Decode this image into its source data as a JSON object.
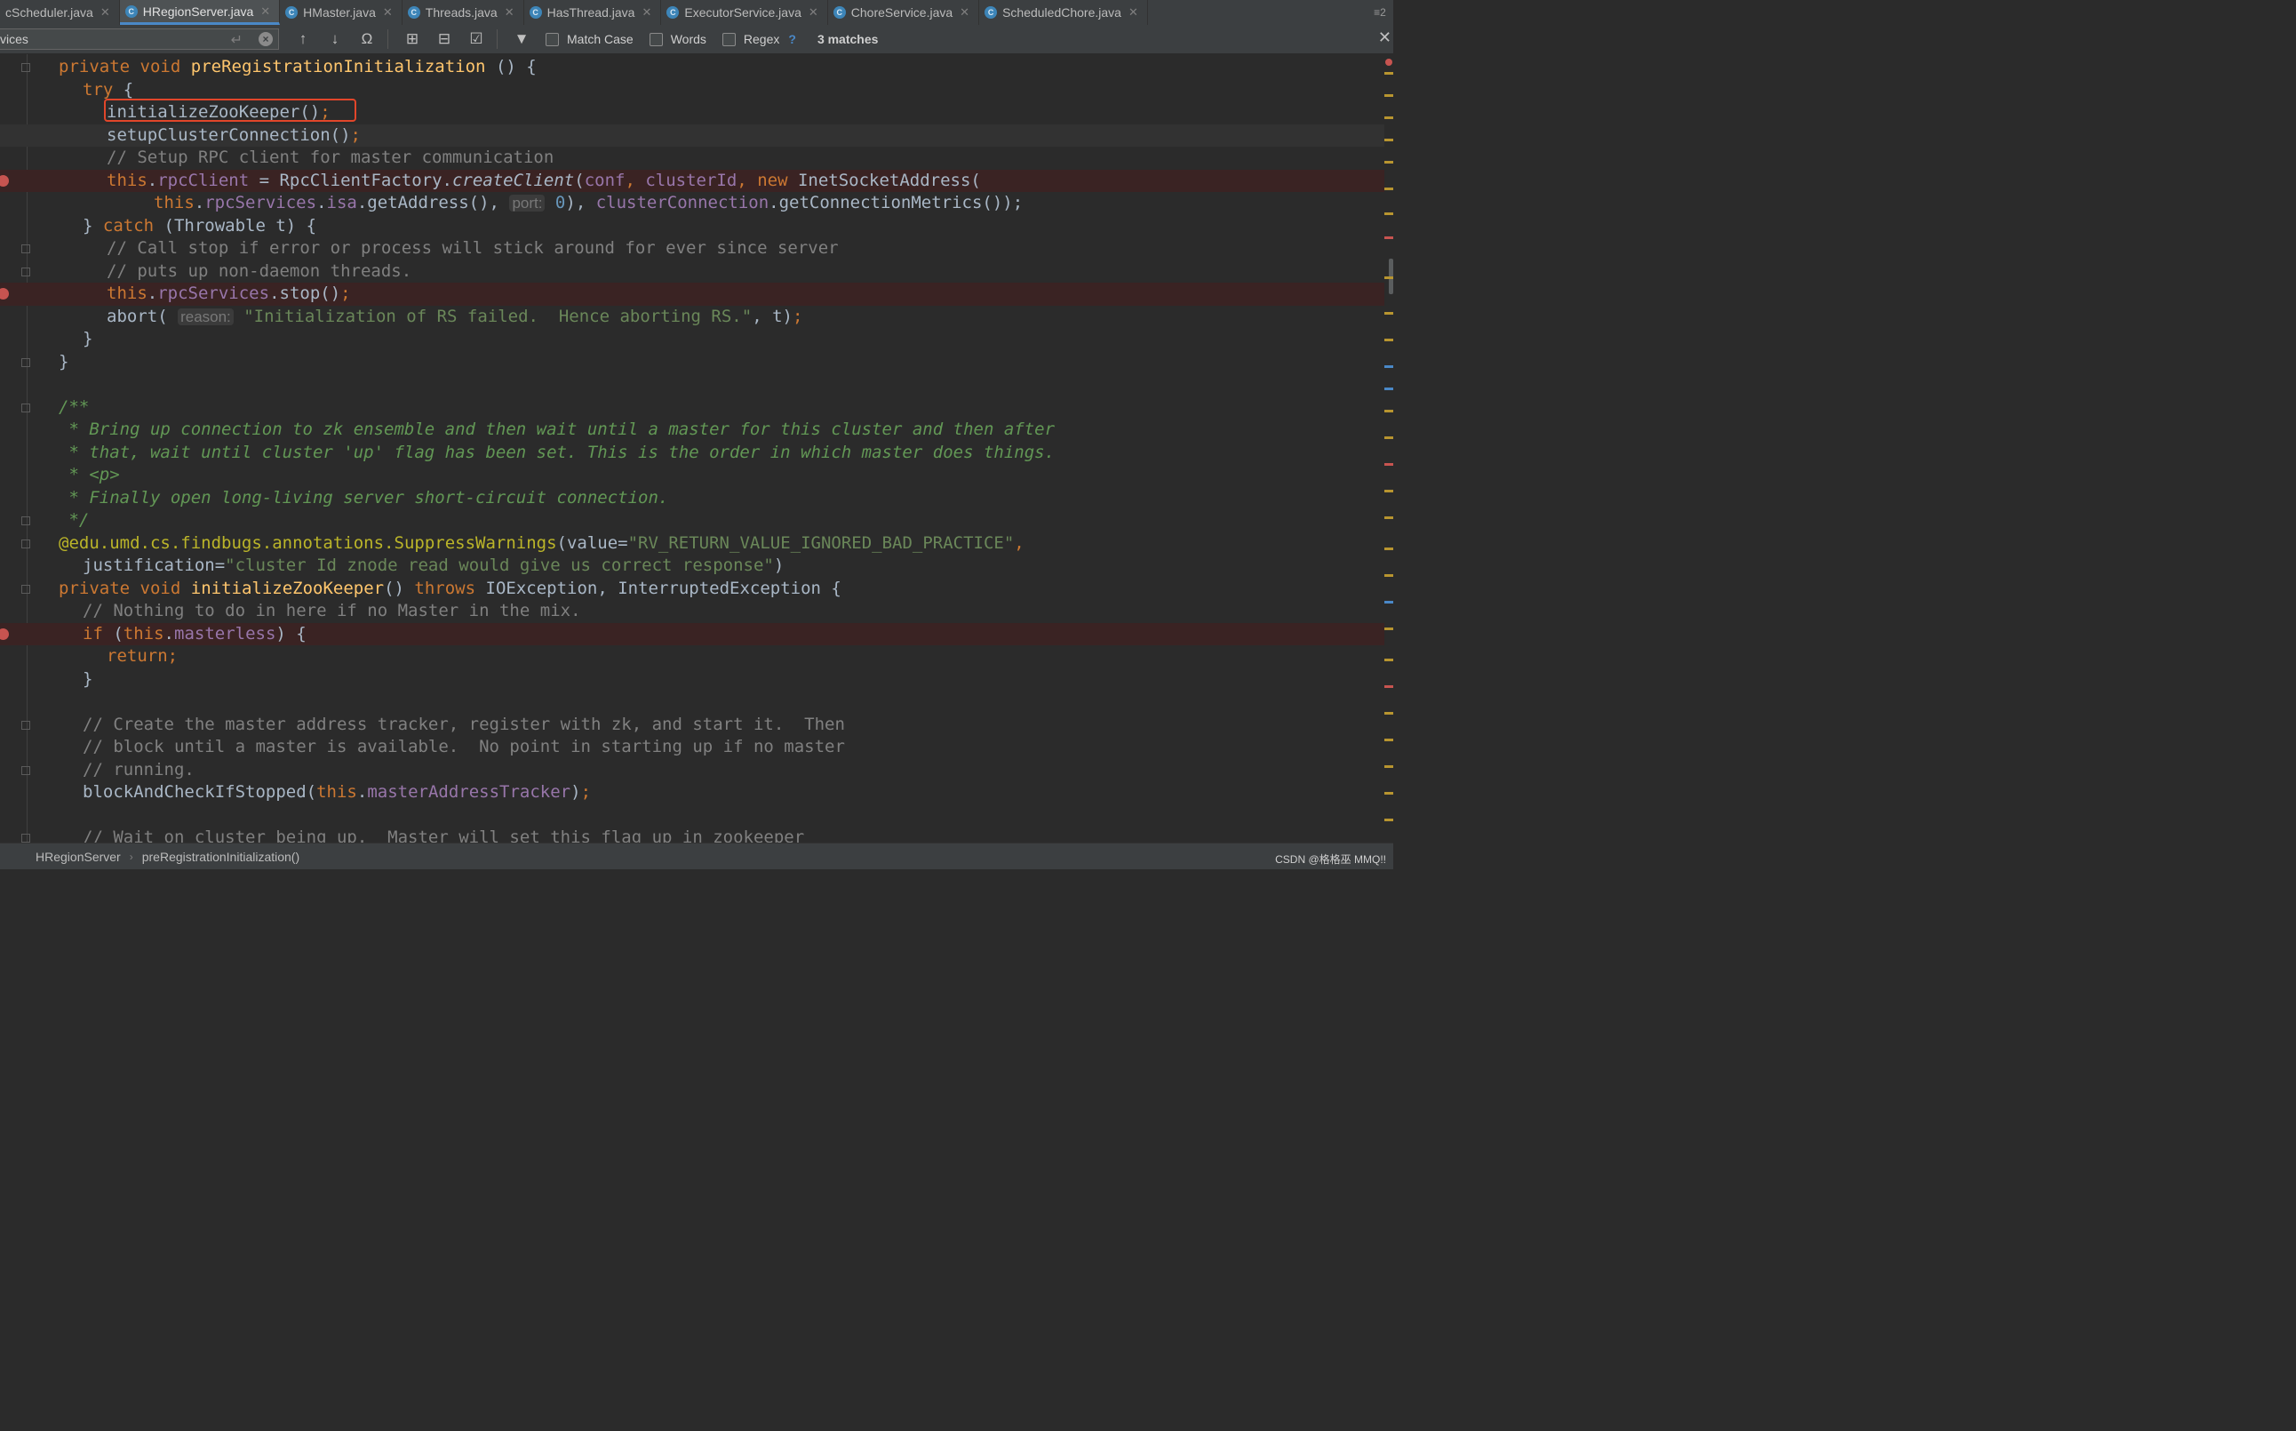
{
  "tabs": [
    {
      "label": "cScheduler.java",
      "icon": "",
      "active": false
    },
    {
      "label": "HRegionServer.java",
      "icon": "C",
      "active": true
    },
    {
      "label": "HMaster.java",
      "icon": "C",
      "active": false
    },
    {
      "label": "Threads.java",
      "icon": "C",
      "active": false
    },
    {
      "label": "HasThread.java",
      "icon": "C",
      "active": false
    },
    {
      "label": "ExecutorService.java",
      "icon": "C",
      "active": false
    },
    {
      "label": "ChoreService.java",
      "icon": "C",
      "active": false
    },
    {
      "label": "ScheduledChore.java",
      "icon": "C",
      "active": false
    }
  ],
  "tab_menu_label": "≡2",
  "search": {
    "value": "vices",
    "match_case_label": "Match Case",
    "words_label": "Words",
    "regex_label": "Regex",
    "regex_help": "?",
    "match_count": "3 matches"
  },
  "code": {
    "l1": [
      "private",
      "void",
      "preRegistrationInitialization",
      "() {"
    ],
    "l2": [
      "try",
      " {"
    ],
    "l3": [
      "initializeZooKeeper()",
      ";"
    ],
    "l4": [
      "setupClusterConnection()",
      ";"
    ],
    "l5": "// Setup RPC client for master communication",
    "l6": [
      "this",
      ".",
      "rpcClient",
      " = RpcClientFactory.",
      "createClient",
      "(",
      "conf",
      ", ",
      "clusterId",
      ", ",
      "new",
      " InetSocketAddress("
    ],
    "l7": [
      "this",
      ".",
      "rpcServices",
      ".",
      "isa",
      ".getAddress(), ",
      "port:",
      " ",
      "0",
      "), ",
      "clusterConnection",
      ".getConnectionMetrics());"
    ],
    "l8": [
      "} ",
      "catch",
      " (Throwable t) {"
    ],
    "l9": "// Call stop if error or process will stick around for ever since server",
    "l10": "// puts up non-daemon threads.",
    "l11": [
      "this",
      ".",
      "rpcServices",
      ".stop()",
      ";"
    ],
    "l12": [
      "abort( ",
      "reason:",
      " ",
      "\"Initialization of RS failed.  Hence aborting RS.\"",
      ", t)",
      ";"
    ],
    "l13": "}",
    "l14": "}",
    "l16": "/**",
    "l17": " * Bring up connection to zk ensemble and then wait until a master for this cluster and then after",
    "l18": " * that, wait until cluster 'up' flag has been set. This is the order in which master does things.",
    "l19": " * <p>",
    "l20": " * Finally open long-living server short-circuit connection.",
    "l21": " */",
    "l22": [
      "@edu.umd.cs.findbugs.annotations.",
      "SuppressWarnings",
      "(value=",
      "\"RV_RETURN_VALUE_IGNORED_BAD_PRACTICE\"",
      ","
    ],
    "l23": [
      "justification=",
      "\"cluster Id znode read would give us correct response\"",
      ")"
    ],
    "l24": [
      "private",
      "void",
      "initializeZooKeeper",
      "() ",
      "throws",
      " IOException, InterruptedException {"
    ],
    "l25": "// Nothing to do in here if no Master in the mix.",
    "l26": [
      "if",
      " (",
      "this",
      ".",
      "masterless",
      ") {"
    ],
    "l27": [
      "return",
      ";"
    ],
    "l28": "}",
    "l30": "// Create the master address tracker, register with zk, and start it.  Then",
    "l31": "// block until a master is available.  No point in starting up if no master",
    "l32": "// running.",
    "l33": [
      "blockAndCheckIfStopped(",
      "this",
      ".",
      "masterAddressTracker",
      ")",
      ";"
    ],
    "l35": "// Wait on cluster being up.  Master will set this flag up in zookeeper"
  },
  "breadcrumb": {
    "class_name": "HRegionServer",
    "method_name": "preRegistrationInitialization()"
  },
  "watermark": "CSDN @格格巫 MMQ!!",
  "colors": {
    "keyword": "#cc7832",
    "method": "#ffc66d",
    "field": "#9876aa",
    "comment": "#808080",
    "doc_comment": "#629755",
    "string": "#6a8759",
    "number": "#6897bb",
    "annotation": "#bbb529",
    "highlight_box": "#e2462a",
    "breakpoint": "#c75450"
  }
}
